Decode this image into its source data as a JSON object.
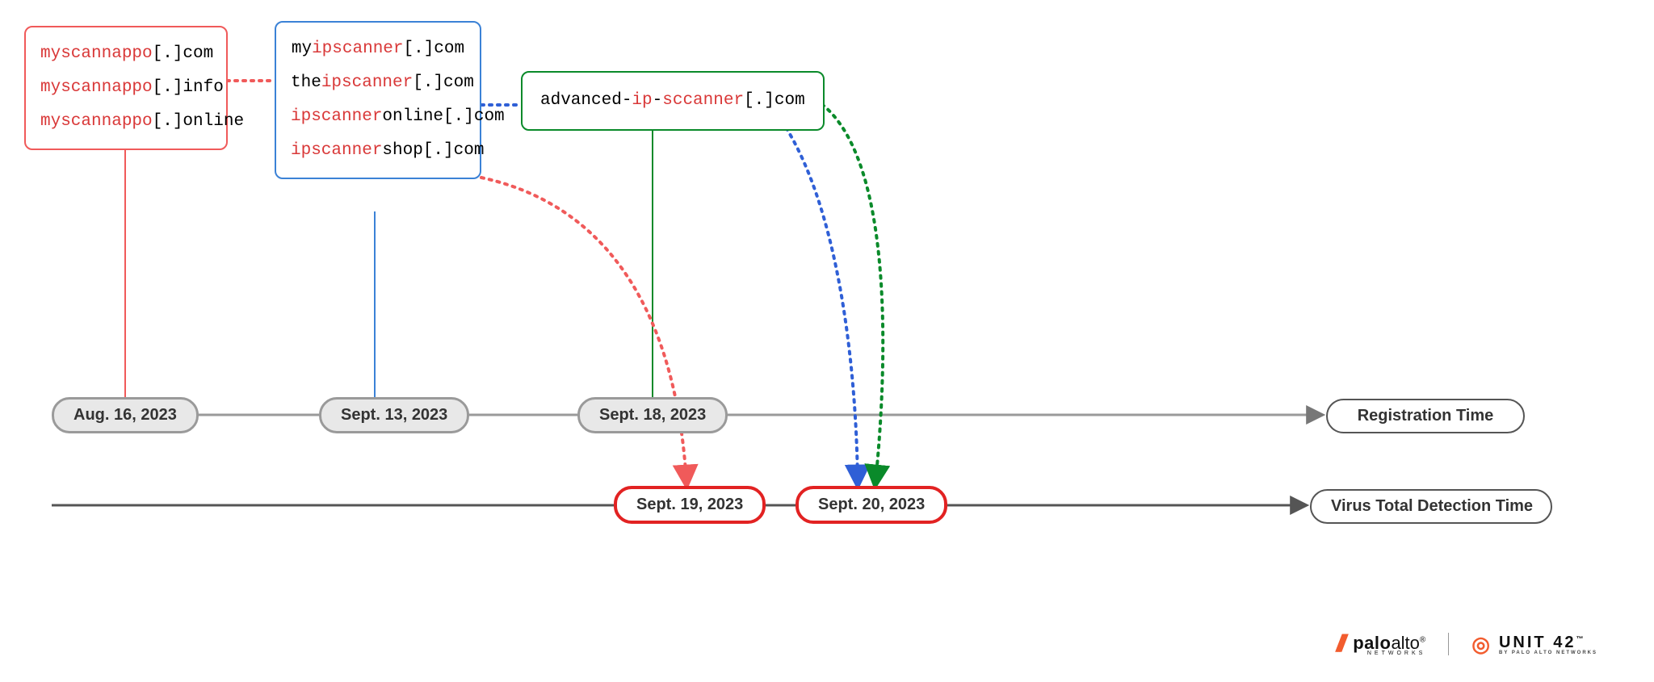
{
  "boxes": {
    "red": {
      "lines": [
        [
          {
            "t": "myscannappo",
            "c": "r"
          },
          {
            "t": "[.]com",
            "c": "p"
          }
        ],
        [
          {
            "t": "myscannappo",
            "c": "r"
          },
          {
            "t": "[.]info",
            "c": "p"
          }
        ],
        [
          {
            "t": "myscannappo",
            "c": "r"
          },
          {
            "t": "[.]online",
            "c": "p"
          }
        ]
      ]
    },
    "blue": {
      "lines": [
        [
          {
            "t": "my",
            "c": "p"
          },
          {
            "t": "ipscanner",
            "c": "r"
          },
          {
            "t": "[.]com",
            "c": "p"
          }
        ],
        [
          {
            "t": "the",
            "c": "p"
          },
          {
            "t": "ipscanner",
            "c": "r"
          },
          {
            "t": "[.]com",
            "c": "p"
          }
        ],
        [
          {
            "t": "ipscanner",
            "c": "r"
          },
          {
            "t": "online[.]com",
            "c": "p"
          }
        ],
        [
          {
            "t": "ipscanner",
            "c": "r"
          },
          {
            "t": "shop[.]com",
            "c": "p"
          }
        ]
      ]
    },
    "green": {
      "lines": [
        [
          {
            "t": "advanced-",
            "c": "p"
          },
          {
            "t": "ip",
            "c": "r"
          },
          {
            "t": "-",
            "c": "p"
          },
          {
            "t": "sccanner",
            "c": "r"
          },
          {
            "t": "[.]com",
            "c": "p"
          }
        ]
      ]
    }
  },
  "dates": {
    "reg1": "Aug. 16, 2023",
    "reg2": "Sept. 13, 2023",
    "reg3": "Sept. 18, 2023",
    "det1": "Sept. 19, 2023",
    "det2": "Sept. 20, 2023"
  },
  "labels": {
    "registration": "Registration Time",
    "detection": "Virus Total Detection Time"
  },
  "footer": {
    "pa_slashes": "///",
    "pa_1": "palo",
    "pa_2": "alto",
    "pa_sub": "NETWORKS",
    "u42_mark": "◎",
    "u42_text": "UNIT 42",
    "u42_sub": "BY PALO ALTO NETWORKS"
  }
}
